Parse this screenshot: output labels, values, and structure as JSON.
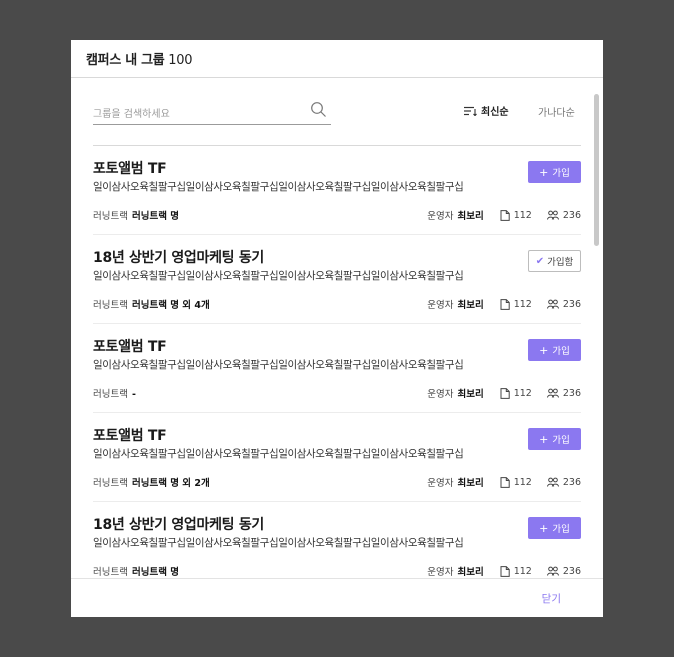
{
  "modal": {
    "title": "캠퍼스 내 그룹",
    "count": "100",
    "close_label": "닫기"
  },
  "search": {
    "placeholder": "그룹을 검색하세요",
    "value": ""
  },
  "sort": {
    "latest_label": "최신순",
    "alpha_label": "가나다순",
    "active": "latest"
  },
  "colors": {
    "accent": "#8b78f0",
    "backdrop": "#4a4a4a"
  },
  "labels": {
    "learning_track": "러닝트랙",
    "operator": "운영자",
    "join": "가입",
    "joined": "가입함"
  },
  "groups": [
    {
      "title": "포토앨범 TF",
      "description": "일이삼사오육칠팔구십일이삼사오육칠팔구십일이삼사오육칠팔구십일이삼사오육칠팔구십",
      "track": "러닝트랙 명",
      "operator": "최보리",
      "posts": "112",
      "members": "236",
      "joined": false
    },
    {
      "title": "18년 상반기 영업마케팅 동기",
      "description": "일이삼사오육칠팔구십일이삼사오육칠팔구십일이삼사오육칠팔구십일이삼사오육칠팔구십",
      "track": "러닝트랙 명 외 4개",
      "operator": "최보리",
      "posts": "112",
      "members": "236",
      "joined": true
    },
    {
      "title": "포토앨범 TF",
      "description": "일이삼사오육칠팔구십일이삼사오육칠팔구십일이삼사오육칠팔구십일이삼사오육칠팔구십",
      "track": "-",
      "operator": "최보리",
      "posts": "112",
      "members": "236",
      "joined": false
    },
    {
      "title": "포토앨범 TF",
      "description": "일이삼사오육칠팔구십일이삼사오육칠팔구십일이삼사오육칠팔구십일이삼사오육칠팔구십",
      "track": "러닝트랙 명 외 2개",
      "operator": "최보리",
      "posts": "112",
      "members": "236",
      "joined": false
    },
    {
      "title": "18년 상반기 영업마케팅 동기",
      "description": "일이삼사오육칠팔구십일이삼사오육칠팔구십일이삼사오육칠팔구십일이삼사오육칠팔구십",
      "track": "러닝트랙 명",
      "operator": "최보리",
      "posts": "112",
      "members": "236",
      "joined": false
    }
  ]
}
